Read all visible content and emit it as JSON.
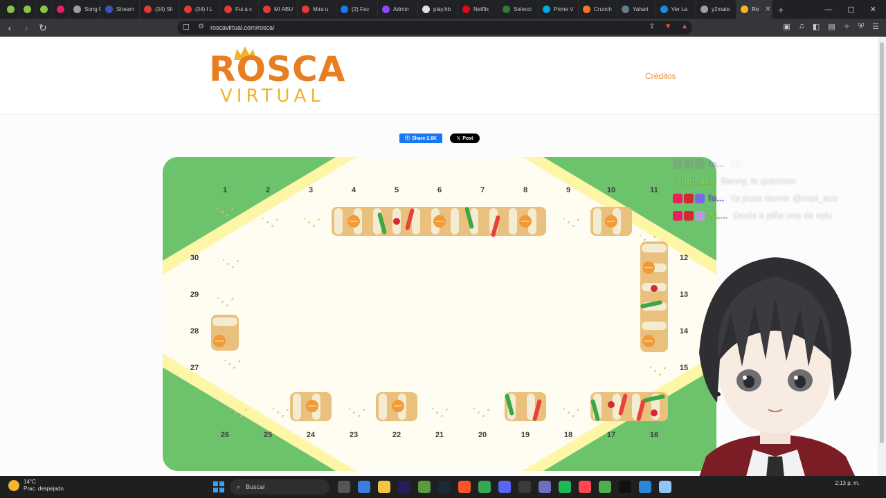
{
  "browser": {
    "tabs": [
      {
        "label": "",
        "color": "#8bc34a"
      },
      {
        "label": "",
        "color": "#8bc34a"
      },
      {
        "label": "",
        "color": "#8bc34a"
      },
      {
        "label": "",
        "color": "#e91e63"
      },
      {
        "label": "Song R",
        "color": "#9e9e9e"
      },
      {
        "label": "Stream",
        "color": "#3f51b5"
      },
      {
        "label": "(34) Sli",
        "color": "#e53935"
      },
      {
        "label": "(34) I L",
        "color": "#e53935"
      },
      {
        "label": "Fui a c",
        "color": "#e53935"
      },
      {
        "label": "MI ABU",
        "color": "#e53935"
      },
      {
        "label": "Mira u",
        "color": "#e53935"
      },
      {
        "label": "(2) Fac",
        "color": "#1877f2"
      },
      {
        "label": "Admin",
        "color": "#9146ff"
      },
      {
        "label": "play.hb",
        "color": "#e0e0e0"
      },
      {
        "label": "Netflix",
        "color": "#e50914"
      },
      {
        "label": "Selecci",
        "color": "#2e7d32"
      },
      {
        "label": "Prime V",
        "color": "#00a8e1"
      },
      {
        "label": "Crunch",
        "color": "#f47521"
      },
      {
        "label": "Yahari",
        "color": "#607d8b"
      },
      {
        "label": "Ver La",
        "color": "#1e88e5"
      },
      {
        "label": "y2mate",
        "color": "#9e9e9e"
      },
      {
        "label": "Ro",
        "color": "#f1b329",
        "active": true
      }
    ],
    "new_tab": "+",
    "window_controls": {
      "minimize": "—",
      "maximize": "▢",
      "close": "✕"
    },
    "url": "roscavirtual.com/rosca/"
  },
  "site": {
    "logo": {
      "top": "ROSCA",
      "bottom": "VIRTUAL"
    },
    "nav": {
      "creditos": "Créditos"
    },
    "share": {
      "facebook": "Share 2.6K",
      "x_post": "Post"
    }
  },
  "board": {
    "colors": {
      "green": "#6cc36c",
      "cream": "#fffdf1",
      "stripe": "#fdf6a6",
      "bread": "#e9c07e",
      "icing": "#f4ecd2",
      "orange": "#f29a38",
      "cherry": "#d62734",
      "ate": "#e8403a",
      "greenfruit": "#3aa844"
    },
    "top_numbers": [
      "1",
      "2",
      "3",
      "4",
      "5",
      "6",
      "7",
      "8",
      "9",
      "10",
      "11"
    ],
    "right_numbers": [
      "12",
      "13",
      "14",
      "15"
    ],
    "bottom_numbers": [
      "26",
      "25",
      "24",
      "23",
      "22",
      "21",
      "20",
      "19",
      "18",
      "17",
      "16"
    ],
    "left_numbers": [
      "30",
      "29",
      "28",
      "27"
    ],
    "remaining_pieces_top": [
      "4",
      "5",
      "6",
      "7",
      "8",
      "10"
    ],
    "remaining_pieces_right": [
      "12",
      "13",
      "14"
    ],
    "remaining_pieces_bottom": [
      "24",
      "22",
      "19",
      "17",
      "16"
    ],
    "remaining_pieces_left": [
      "28"
    ]
  },
  "chat": [
    {
      "user": "fo...",
      "message": "XD",
      "user_color": "#6a5acd",
      "faded": true
    },
    {
      "user": "sopi_aco",
      "message": "Benny, te quierooo",
      "user_color": "#8fd14f"
    },
    {
      "user": "fo...",
      "message": "Ya pues dormir @sopi_aco",
      "user_color": "#6a5acd"
    },
    {
      "user": "AL...",
      "message": "Denle a piña uno de sylu",
      "user_color": "#8fd14f"
    }
  ],
  "taskbar": {
    "weather_temp": "14°C",
    "weather_desc": "Prac. despejado",
    "search": "Buscar",
    "clock_time": "2:13 p. m."
  }
}
